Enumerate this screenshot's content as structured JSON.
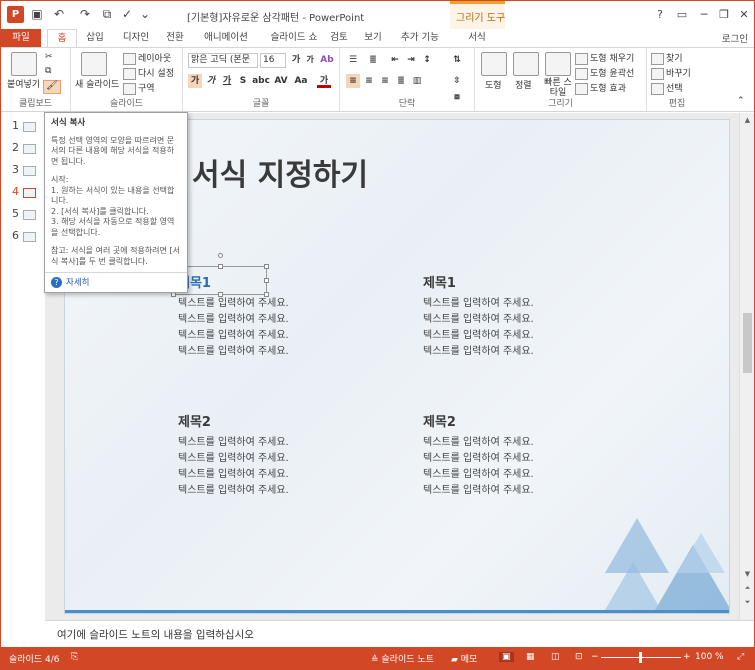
{
  "window": {
    "title": "[기본형]자유로운 삼각패턴 - PowerPoint",
    "context_group": "그리기 도구",
    "login": "로그인",
    "help": "?"
  },
  "tabs": [
    {
      "label": "파일"
    },
    {
      "label": "홈"
    },
    {
      "label": "삽입"
    },
    {
      "label": "디자인"
    },
    {
      "label": "전환"
    },
    {
      "label": "애니메이션"
    },
    {
      "label": "슬라이드 쇼"
    },
    {
      "label": "검토"
    },
    {
      "label": "보기"
    },
    {
      "label": "추가 기능"
    },
    {
      "label": "서식"
    }
  ],
  "ribbon": {
    "clipboard": {
      "paste": "붙여넣기",
      "label": "클립보드"
    },
    "slides": {
      "new_slide": "새 슬라이드",
      "layout": "레이아웃",
      "reset": "다시 설정",
      "section": "구역",
      "label": "슬라이드"
    },
    "font": {
      "name": "맑은 고딕 (본문",
      "size": "16",
      "label": "글꼴",
      "grow": "가",
      "shrink": "가",
      "clear": "Ab",
      "bold": "가",
      "italic": "가",
      "underline": "가",
      "strike": "S",
      "shadow": "abc",
      "spacing": "AV",
      "case": "Aa",
      "color": "가"
    },
    "paragraph": {
      "label": "단락"
    },
    "drawing": {
      "shapes": "도형",
      "arrange": "정렬",
      "quick_styles": "빠른 스타일",
      "fill": "도형 채우기",
      "outline": "도형 윤곽선",
      "effects": "도형 효과",
      "label": "그리기"
    },
    "editing": {
      "find": "찾기",
      "replace": "바꾸기",
      "select": "선택",
      "label": "편집"
    }
  },
  "thumbnails": [
    "1",
    "2",
    "3",
    "4",
    "5",
    "6"
  ],
  "active_slide": "4",
  "tooltip": {
    "title": "서식 복사",
    "desc": "특정 선택 영역의 모양을 따르려면 문서의 다른 내용에 해당 서식을 적용하면 됩니다.",
    "start": "시작:",
    "step1": "1. 원하는 서식이 있는 내용을 선택합니다.",
    "step2": "2. [서식 복사]를 클릭합니다.",
    "step3": "3. 해당 서식을 자동으로 적용할 영역을 선택합니다.",
    "note": "참고: 서식을 여러 곳에 적용하려면 [서식 복사]를 두 번 클릭합니다.",
    "more": "자세히"
  },
  "slide": {
    "title": "서식 지정하기",
    "blocks": [
      {
        "heading": "제목1",
        "lines": [
          "텍스트를 입력하여 주세요.",
          "텍스트를 입력하여 주세요.",
          "텍스트를 입력하여 주세요.",
          "텍스트를 입력하여 주세요."
        ]
      },
      {
        "heading": "제목1",
        "lines": [
          "텍스트를 입력하여 주세요.",
          "텍스트를 입력하여 주세요.",
          "텍스트를 입력하여 주세요.",
          "텍스트를 입력하여 주세요."
        ]
      },
      {
        "heading": "제목2",
        "lines": [
          "텍스트를 입력하여 주세요.",
          "텍스트를 입력하여 주세요.",
          "텍스트를 입력하여 주세요.",
          "텍스트를 입력하여 주세요."
        ]
      },
      {
        "heading": "제목2",
        "lines": [
          "텍스트를 입력하여 주세요.",
          "텍스트를 입력하여 주세요.",
          "텍스트를 입력하여 주세요.",
          "텍스트를 입력하여 주세요."
        ]
      }
    ]
  },
  "notes_placeholder": "여기에 슬라이드 노트의 내용을 입력하십시오",
  "status": {
    "slide_info": "슬라이드 4/6",
    "notes": "슬라이드 노트",
    "comments": "메모",
    "zoom": "100 %"
  },
  "colors": {
    "accent": "#d24726",
    "context": "#f0a030",
    "heading": "#3a3a3a",
    "link": "#1e5aa8"
  }
}
